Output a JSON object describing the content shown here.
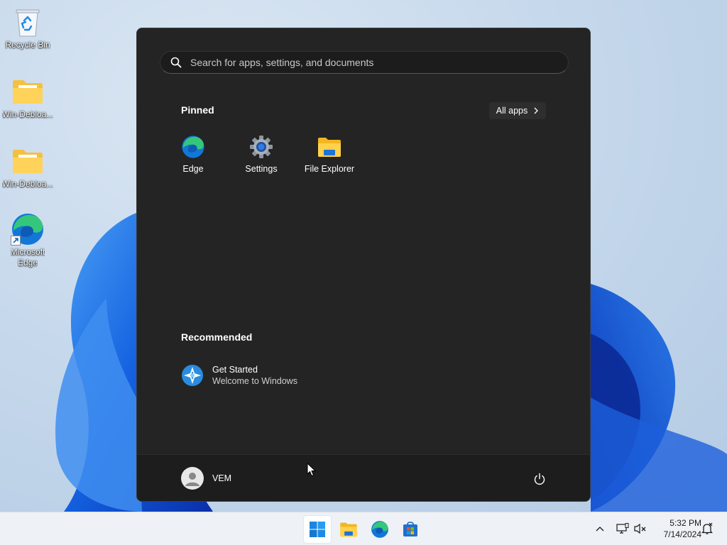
{
  "desktop": {
    "icons": [
      {
        "label": "Recycle Bin",
        "icon": "recycle-bin-icon"
      },
      {
        "label": "Win-Debloa...",
        "icon": "folder-icon"
      },
      {
        "label": "Win-Debloa...",
        "icon": "folder-icon"
      },
      {
        "label_line1": "Microsoft",
        "label_line2": "Edge",
        "icon": "edge-icon"
      }
    ]
  },
  "start_menu": {
    "search": {
      "placeholder": "Search for apps, settings, and documents",
      "icon": "search-icon"
    },
    "pinned": {
      "title": "Pinned",
      "all_apps_label": "All apps",
      "apps": [
        {
          "label": "Edge",
          "icon": "edge-icon"
        },
        {
          "label": "Settings",
          "icon": "gear-icon"
        },
        {
          "label": "File Explorer",
          "icon": "folder-icon"
        }
      ]
    },
    "recommended": {
      "title": "Recommended",
      "items": [
        {
          "title": "Get Started",
          "subtitle": "Welcome to Windows",
          "icon": "get-started-icon"
        }
      ]
    },
    "user": {
      "name": "VEM",
      "icon": "avatar-icon"
    },
    "power_icon": "power-icon"
  },
  "taskbar": {
    "apps": [
      {
        "name": "Start",
        "icon": "windows-logo-icon"
      },
      {
        "name": "File Explorer",
        "icon": "folder-icon"
      },
      {
        "name": "Microsoft Edge",
        "icon": "edge-icon"
      },
      {
        "name": "Microsoft Store",
        "icon": "store-icon"
      }
    ],
    "tray": {
      "icons": [
        "chevron-up-icon",
        "network-icon",
        "volume-muted-icon",
        "notification-icon"
      ],
      "time": "5:32 PM",
      "date": "7/14/2024"
    }
  },
  "colors": {
    "start_bg": "#242424",
    "accent": "#0078d4",
    "taskbar_bg": "#eef1f5"
  }
}
